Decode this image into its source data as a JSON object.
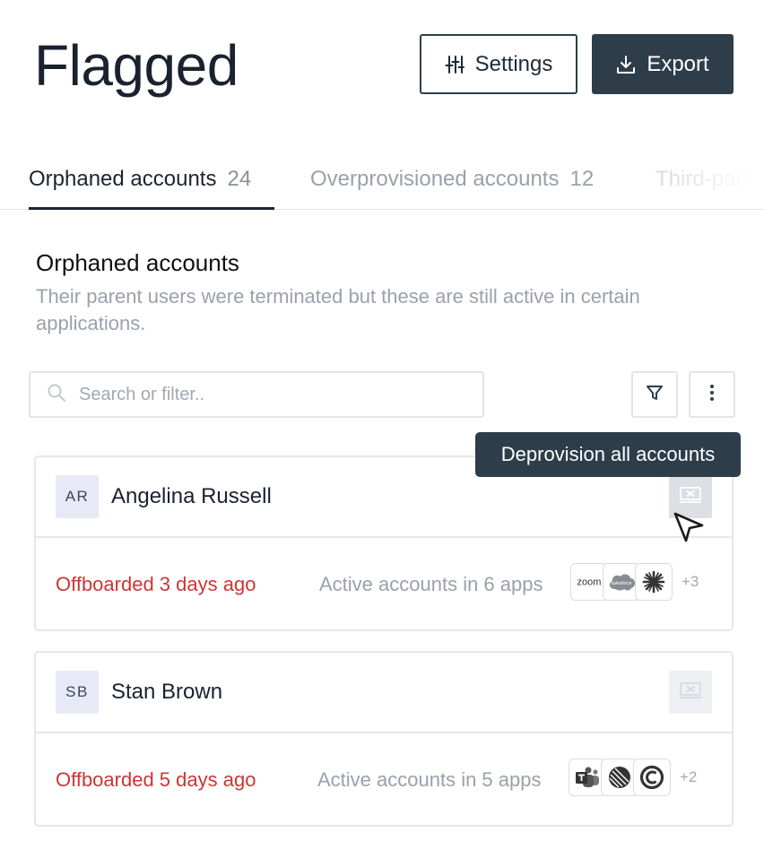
{
  "header": {
    "title": "Flagged",
    "settings_label": "Settings",
    "export_label": "Export"
  },
  "tabs": [
    {
      "label": "Orphaned accounts",
      "count": "24",
      "active": true
    },
    {
      "label": "Overprovisioned accounts",
      "count": "12",
      "active": false
    },
    {
      "label": "Third-part",
      "count": "",
      "active": false
    }
  ],
  "section": {
    "title": "Orphaned accounts",
    "description": "Their parent users were terminated but these are still active in certain applications."
  },
  "search": {
    "placeholder": "Search or filter.."
  },
  "tooltip": {
    "text": "Deprovision all accounts"
  },
  "accounts": [
    {
      "initials": "AR",
      "name": "Angelina Russell",
      "status": "Offboarded 3 days ago",
      "active_text": "Active accounts in 6 apps",
      "apps": [
        "zoom-icon",
        "salesforce-icon",
        "zendesk-icon"
      ],
      "more_apps": "+3",
      "zoom_label": "zoom",
      "salesforce_label": "salesforce"
    },
    {
      "initials": "SB",
      "name": "Stan Brown",
      "status": "Offboarded 5 days ago",
      "active_text": "Active accounts in 5 apps",
      "apps": [
        "teams-icon",
        "linear-icon",
        "calendly-icon"
      ],
      "more_apps": "+2"
    }
  ],
  "colors": {
    "primary": "#2d3e4a",
    "danger": "#cf3434",
    "muted": "#9aa1aa",
    "avatar_bg": "#e7eaf6"
  }
}
